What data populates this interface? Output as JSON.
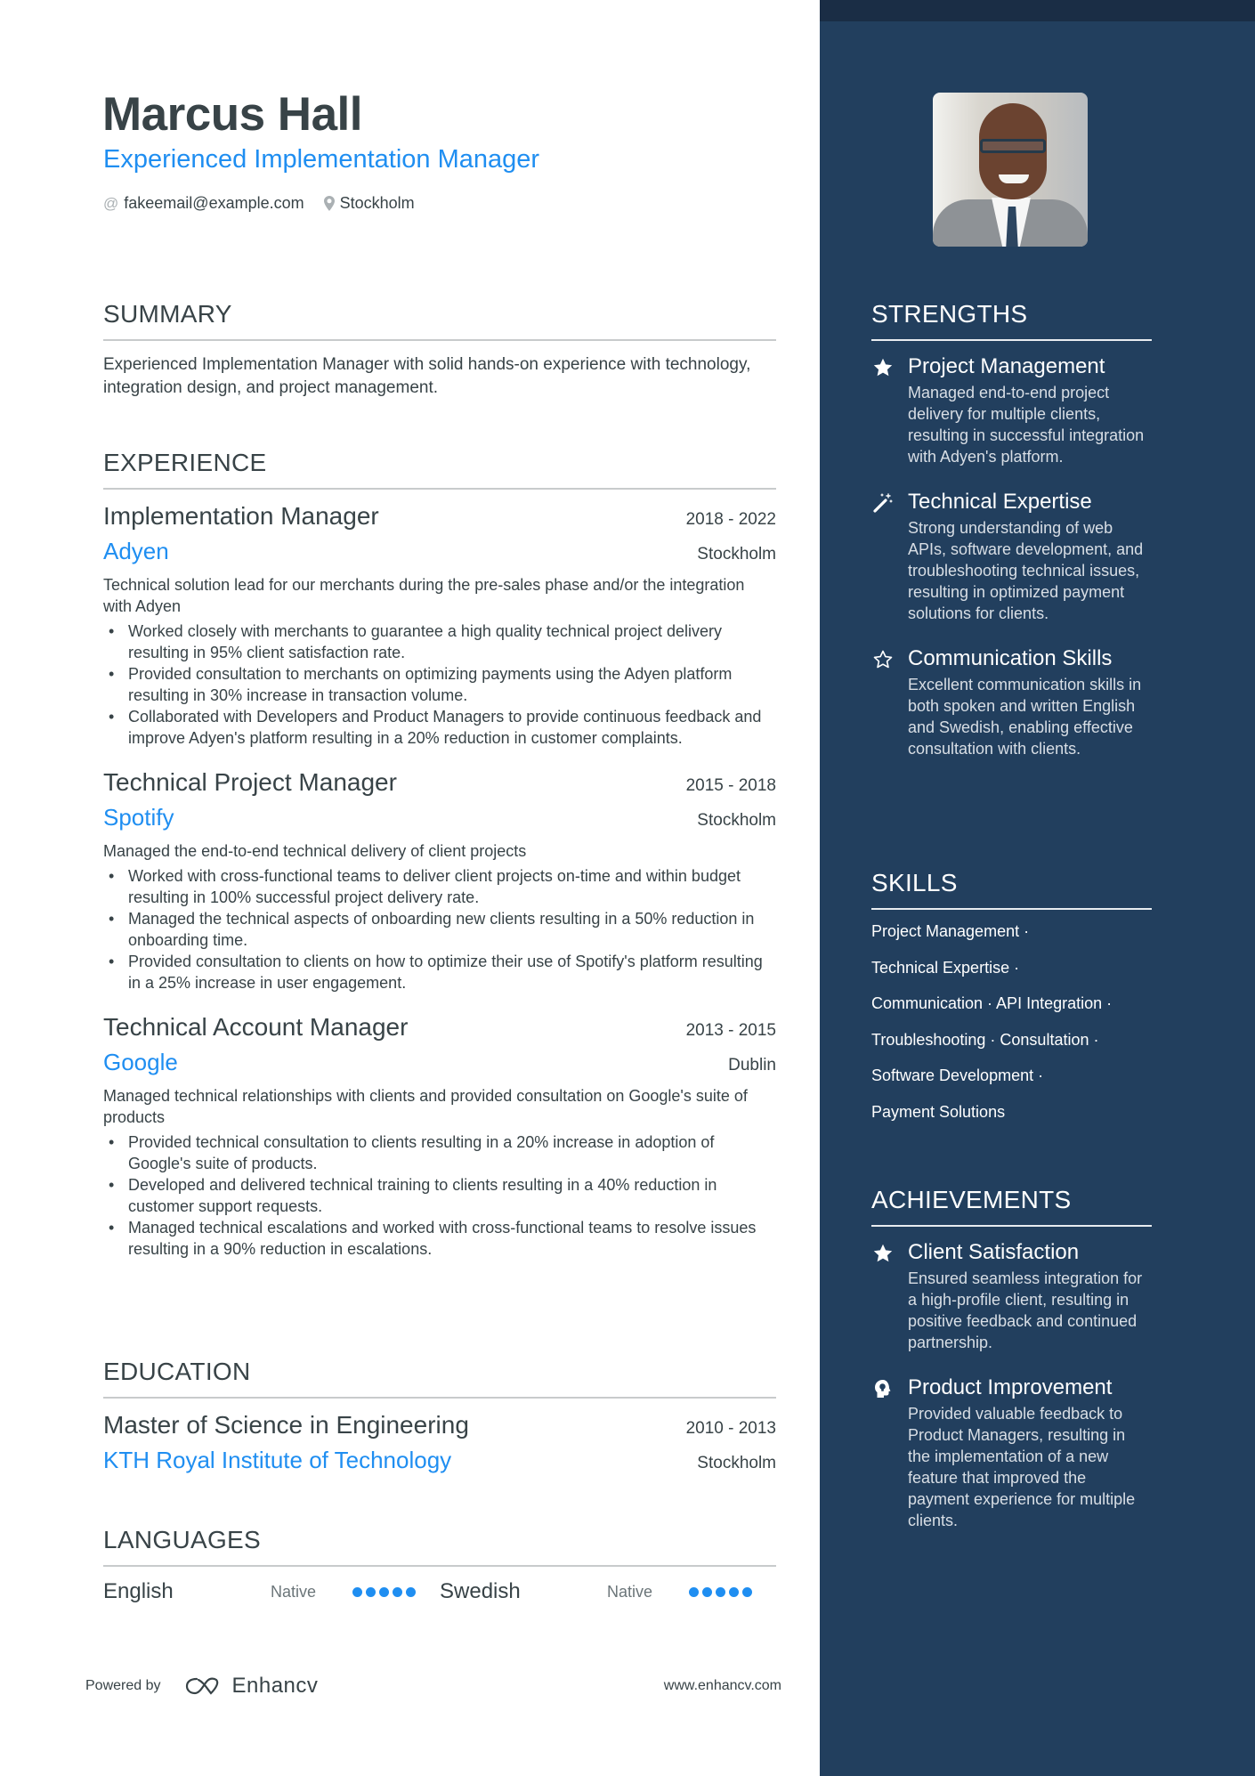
{
  "header": {
    "name": "Marcus Hall",
    "title": "Experienced Implementation Manager",
    "email_icon": "at-icon",
    "email": "fakeemail@example.com",
    "location_icon": "location-pin-icon",
    "location": "Stockholm"
  },
  "summary": {
    "heading": "SUMMARY",
    "text": "Experienced Implementation Manager with solid hands-on experience with technology, integration design, and project management."
  },
  "experience": {
    "heading": "EXPERIENCE",
    "jobs": [
      {
        "title": "Implementation Manager",
        "dates": "2018 - 2022",
        "company": "Adyen",
        "location": "Stockholm",
        "description": "Technical solution lead for our merchants during the pre-sales phase and/or the integration with Adyen",
        "bullets": [
          "Worked closely with merchants to guarantee a high quality technical project delivery resulting in 95% client satisfaction rate.",
          "Provided consultation to merchants on optimizing payments using the Adyen platform resulting in 30% increase in transaction volume.",
          "Collaborated with Developers and Product Managers to provide continuous feedback and improve Adyen's platform resulting in a 20% reduction in customer complaints."
        ]
      },
      {
        "title": "Technical Project Manager",
        "dates": "2015 - 2018",
        "company": "Spotify",
        "location": "Stockholm",
        "description": "Managed the end-to-end technical delivery of client projects",
        "bullets": [
          "Worked with cross-functional teams to deliver client projects on-time and within budget resulting in 100% successful project delivery rate.",
          "Managed the technical aspects of onboarding new clients resulting in a 50% reduction in onboarding time.",
          "Provided consultation to clients on how to optimize their use of Spotify's platform resulting in a 25% increase in user engagement."
        ]
      },
      {
        "title": "Technical Account Manager",
        "dates": "2013 - 2015",
        "company": "Google",
        "location": "Dublin",
        "description": "Managed technical relationships with clients and provided consultation on Google's suite of products",
        "bullets": [
          "Provided technical consultation to clients resulting in a 20% increase in adoption of Google's suite of products.",
          "Developed and delivered technical training to clients resulting in a 40% reduction in customer support requests.",
          "Managed technical escalations and worked with cross-functional teams to resolve issues resulting in a 90% reduction in escalations."
        ]
      }
    ]
  },
  "education": {
    "heading": "EDUCATION",
    "degree": "Master of Science in Engineering",
    "dates": "2010 - 2013",
    "school": "KTH Royal Institute of Technology",
    "location": "Stockholm"
  },
  "languages": {
    "heading": "LANGUAGES",
    "items": [
      {
        "name": "English",
        "level": "Native",
        "rating": 5,
        "max": 5
      },
      {
        "name": "Swedish",
        "level": "Native",
        "rating": 5,
        "max": 5
      }
    ]
  },
  "footer": {
    "powered_by": "Powered by",
    "brand": "Enhancv",
    "website": "www.enhancv.com"
  },
  "sidebar": {
    "photo_alt": "Profile photo of Marcus Hall",
    "strengths": {
      "heading": "STRENGTHS",
      "items": [
        {
          "icon": "star-filled-icon",
          "title": "Project Management",
          "description": "Managed end-to-end project delivery for multiple clients, resulting in successful integration with Adyen's platform."
        },
        {
          "icon": "magic-wand-icon",
          "title": "Technical Expertise",
          "description": "Strong understanding of web APIs, software development, and troubleshooting technical issues, resulting in optimized payment solutions for clients."
        },
        {
          "icon": "star-outline-icon",
          "title": "Communication Skills",
          "description": "Excellent communication skills in both spoken and written English and Swedish, enabling effective consultation with clients."
        }
      ]
    },
    "skills": {
      "heading": "SKILLS",
      "lines": [
        "Project Management ·",
        "Technical Expertise ·",
        "Communication · API Integration ·",
        "Troubleshooting · Consultation ·",
        "Software Development ·",
        "Payment Solutions"
      ]
    },
    "achievements": {
      "heading": "ACHIEVEMENTS",
      "items": [
        {
          "icon": "star-filled-icon",
          "title": "Client Satisfaction",
          "description": "Ensured seamless integration for a high-profile client, resulting in positive feedback and continued partnership."
        },
        {
          "icon": "head-lightbulb-icon",
          "title": "Product Improvement",
          "description": "Provided valuable feedback to Product Managers, resulting in the implementation of a new feature that improved the payment experience for multiple clients."
        }
      ]
    }
  },
  "colors": {
    "accent": "#1f8ef1",
    "text": "#384347",
    "sidebar_bg": "#223f5e",
    "sidebar_topband": "#1a2d45"
  }
}
